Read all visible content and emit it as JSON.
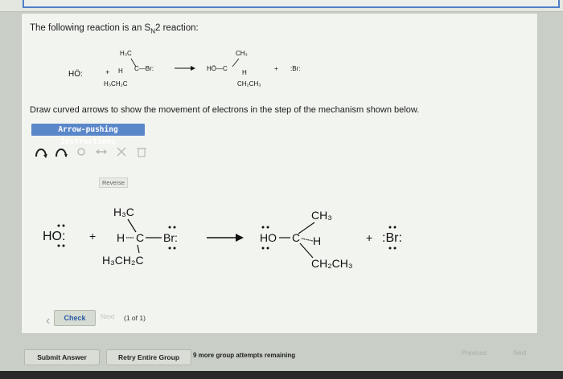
{
  "question": {
    "prefix": "The following reaction is an S",
    "sub": "N",
    "suffix": "2 reaction:"
  },
  "instruction": "Draw curved arrows to show the movement of electrons in the step of the mechanism shown below.",
  "instructions_button": "Arrow-pushing Instructions",
  "tooltip": "Reverse",
  "reaction": {
    "nucleophile": "HO:",
    "plus1": "+",
    "substrate_top": "H3C",
    "substrate_h": "H",
    "substrate_c": "C",
    "substrate_br": "Br:",
    "substrate_bottom": "H3CH2C",
    "product_top": "CH3",
    "product_ho": "HO",
    "product_c": "C",
    "product_h": "H",
    "product_bottom": "CH2CH3",
    "plus2": "+",
    "leaving": ":Br:"
  },
  "buttons": {
    "check": "Check",
    "next": "Next",
    "page_count": "(1 of 1)",
    "submit": "Submit Answer",
    "retry": "Retry Entire Group",
    "attempts": "9 more group attempts remaining",
    "previous": "Previous",
    "next_page": "Next"
  },
  "colors": {
    "accent": "#5a87c9",
    "link": "#2a5aa3"
  },
  "icons": [
    "single-arrow-icon",
    "double-arrow-icon",
    "charge-icon",
    "cross-icon",
    "trash-icon"
  ]
}
